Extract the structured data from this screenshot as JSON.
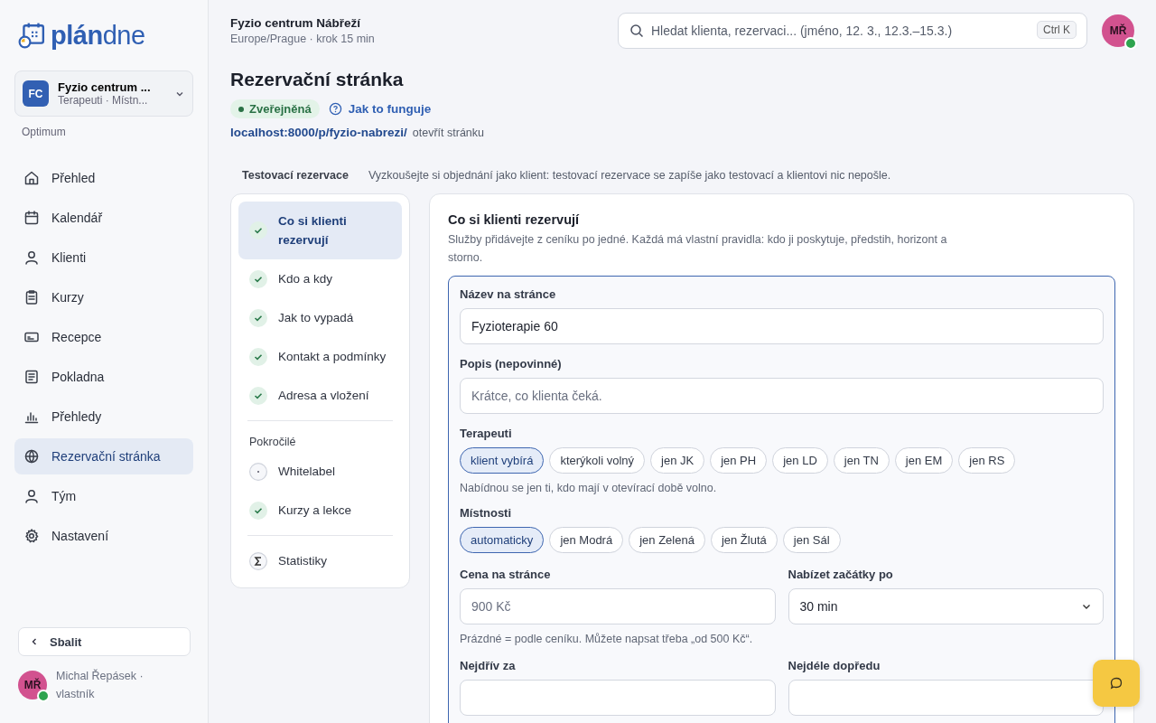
{
  "sidebar": {
    "logo": "**plán**dne",
    "org": {
      "initials": "FC",
      "name": "Fyzio centrum ...",
      "subtitle": "Terapeuti · Místn..."
    },
    "plan": "Optimum",
    "items": [
      {
        "label": "Přehled",
        "selected": false
      },
      {
        "label": "Kalendář",
        "selected": false
      },
      {
        "label": "Klienti",
        "selected": false
      },
      {
        "label": "Kurzy",
        "selected": false
      },
      {
        "label": "Recepce",
        "selected": false
      },
      {
        "label": "Pokladna",
        "selected": false
      },
      {
        "label": "Přehledy",
        "selected": false
      },
      {
        "label": "Rezervační stránka",
        "selected": true
      },
      {
        "label": "Tým",
        "selected": false
      },
      {
        "label": "Nastavení",
        "selected": false
      }
    ],
    "collapse": "Sbalit",
    "user": {
      "initials": "MŘ",
      "name": "Michal Řepásek · vlastník",
      "online": true
    }
  },
  "header": {
    "title": "Fyzio centrum Nábřeží",
    "subtitle": "Europe/Prague · krok 15 min",
    "search": {
      "placeholder": "Hledat klienta, rezervaci... (jméno, 12. 3., 12.3.–15.3.)",
      "shortcut": "Ctrl K"
    },
    "avatar": {
      "initials": "MŘ",
      "online": true
    }
  },
  "page": {
    "title": "Rezervační stránka",
    "status": "Zveřejněná",
    "help": "Jak to funguje",
    "url": "localhost:8000/p/fyzio-nabrezi/",
    "open": "otevřít stránku"
  },
  "test_bar": {
    "label": "Testovací rezervace",
    "text": "Vyzkoušejte si objednání jako klient: testovací rezervace se zapíše jako testovací a klientovi nic nepošle."
  },
  "steps": [
    {
      "label": "Co si klienti rezervují",
      "kind": "done",
      "selected": true
    },
    {
      "label": "Kdo a kdy",
      "kind": "done",
      "selected": false
    },
    {
      "label": "Jak to vypadá",
      "kind": "done",
      "selected": false
    },
    {
      "label": "Kontakt a podmínky",
      "kind": "done",
      "selected": false
    },
    {
      "label": "Adresa a vložení",
      "kind": "done",
      "selected": false
    },
    {
      "kind": "divider"
    },
    {
      "label": "Pokročilé",
      "kind": "heading"
    },
    {
      "label": "Whitelabel",
      "kind": "optional",
      "selected": false
    },
    {
      "label": "Kurzy a lekce",
      "kind": "done",
      "selected": false
    },
    {
      "kind": "divider"
    },
    {
      "label": "Statistiky",
      "kind": "stats",
      "selected": false
    }
  ],
  "form": {
    "title": "Co si klienti rezervují",
    "intro": "Služby přidávejte z ceníku po jedné. Každá má vlastní pravidla: kdo ji poskytuje, předstih, horizont a storno.",
    "name": {
      "label": "Název na stránce",
      "value": "Fyzioterapie 60"
    },
    "description": {
      "label": "Popis (nepovinné)",
      "placeholder": "Krátce, co klienta čeká."
    },
    "therapists": {
      "label": "Terapeuti",
      "options": [
        {
          "label": "klient vybírá",
          "selected": true
        },
        {
          "label": "kterýkoli volný",
          "selected": false
        },
        {
          "label": "jen JK",
          "selected": false
        },
        {
          "label": "jen PH",
          "selected": false
        },
        {
          "label": "jen LD",
          "selected": false
        },
        {
          "label": "jen TN",
          "selected": false
        },
        {
          "label": "jen EM",
          "selected": false
        },
        {
          "label": "jen RS",
          "selected": false
        }
      ],
      "hint": "Nabídnou se jen ti, kdo mají v otevírací době volno."
    },
    "rooms": {
      "label": "Místnosti",
      "options": [
        {
          "label": "automaticky",
          "selected": true
        },
        {
          "label": "jen Modrá",
          "selected": false
        },
        {
          "label": "jen Zelená",
          "selected": false
        },
        {
          "label": "jen Žlutá",
          "selected": false
        },
        {
          "label": "jen Sál",
          "selected": false
        }
      ]
    },
    "price": {
      "label": "Cena na stránce",
      "placeholder": "900 Kč",
      "hint": "Prázdné = podle ceníku. Můžete napsat třeba „od 500 Kč“."
    },
    "start_step": {
      "label": "Nabízet začátky po",
      "value": "30 min"
    },
    "earliest": {
      "label": "Nejdřív za"
    },
    "latest": {
      "label": "Nejdéle dopředu"
    }
  }
}
